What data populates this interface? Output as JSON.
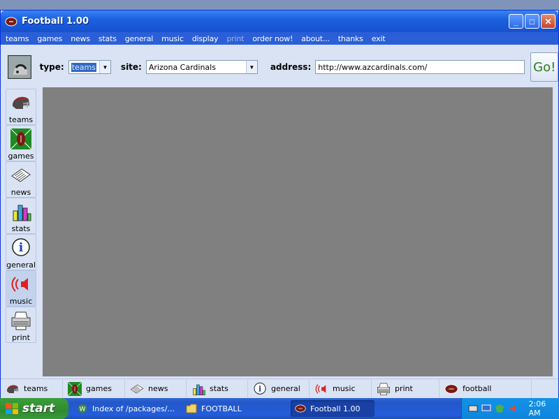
{
  "window": {
    "title": "Football 1.00",
    "minimize": "_",
    "maximize": "□",
    "close": "✕"
  },
  "menu": [
    "teams",
    "games",
    "news",
    "stats",
    "general",
    "music",
    "display",
    "print",
    "order now!",
    "about...",
    "thanks",
    "exit"
  ],
  "menu_disabled_index": 7,
  "addressbar": {
    "type_label": "type:",
    "type_value": "teams",
    "site_label": "site:",
    "site_value": "Arizona Cardinals",
    "address_label": "address:",
    "address_value": "http://www.azcardinals.com/",
    "go_label": "Go!"
  },
  "sidebar": {
    "items": [
      {
        "label": "teams",
        "icon": "helmet-icon"
      },
      {
        "label": "games",
        "icon": "football-field-icon"
      },
      {
        "label": "news",
        "icon": "newspaper-icon"
      },
      {
        "label": "stats",
        "icon": "bar-chart-icon"
      },
      {
        "label": "general",
        "icon": "info-icon"
      },
      {
        "label": "music",
        "icon": "speaker-icon"
      },
      {
        "label": "print",
        "icon": "printer-icon"
      }
    ]
  },
  "tabs": [
    {
      "label": "teams",
      "icon": "helmet-icon"
    },
    {
      "label": "games",
      "icon": "football-field-icon"
    },
    {
      "label": "news",
      "icon": "newspaper-icon"
    },
    {
      "label": "stats",
      "icon": "bar-chart-icon"
    },
    {
      "label": "general",
      "icon": "info-icon"
    },
    {
      "label": "music",
      "icon": "speaker-icon"
    },
    {
      "label": "print",
      "icon": "printer-icon"
    },
    {
      "label": "football",
      "icon": "football-icon"
    }
  ],
  "taskbar": {
    "start_label": "start",
    "tasks": [
      {
        "label": "Index of /packages/...",
        "icon": "browser-icon"
      },
      {
        "label": "FOOTBALL",
        "icon": "folder-icon"
      },
      {
        "label": "Football 1.00",
        "icon": "football-icon"
      }
    ],
    "clock": "2:06 AM"
  }
}
